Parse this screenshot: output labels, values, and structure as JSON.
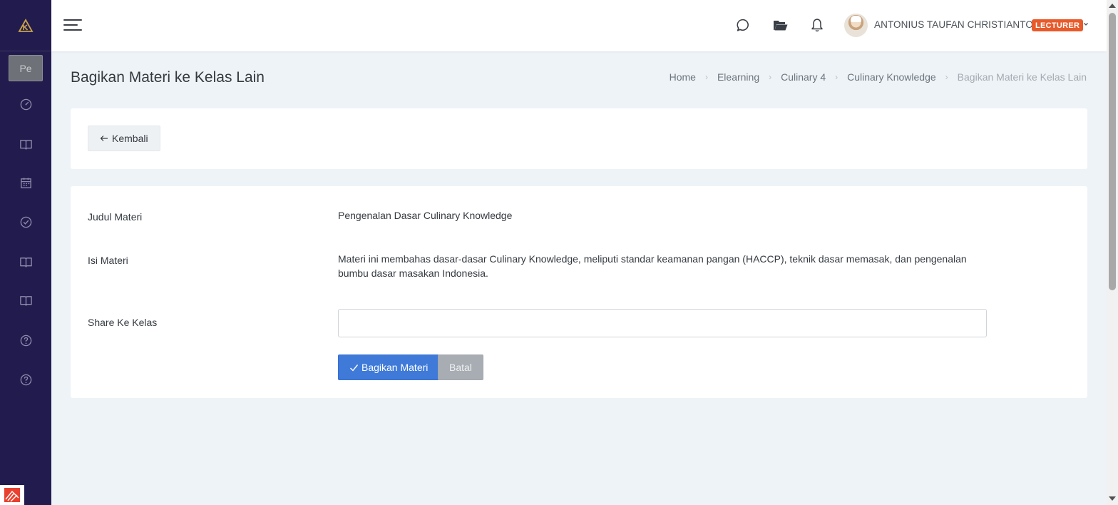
{
  "sidebar": {
    "logo_icon": "app-logo-icon",
    "collapsed_label": "Pe",
    "items": [
      {
        "icon": "dashboard-gauge-icon"
      },
      {
        "icon": "book-open-icon"
      },
      {
        "icon": "calendar-icon"
      },
      {
        "icon": "check-circle-icon"
      },
      {
        "icon": "book-open-icon"
      },
      {
        "icon": "book-open-icon"
      },
      {
        "icon": "help-circle-icon"
      },
      {
        "icon": "help-circle-icon"
      }
    ],
    "colors": {
      "background": "#221c4e",
      "icon": "#8f8cab"
    }
  },
  "topbar": {
    "menu_icon": "hamburger-menu-icon",
    "icons": [
      "chat-bubble-icon",
      "folder-open-icon",
      "bell-icon"
    ],
    "user": {
      "name": "ANTONIUS TAUFAN CHRISTIANTO",
      "role": "LECTURER",
      "role_color": "#e85a2a"
    }
  },
  "page": {
    "title": "Bagikan Materi ke Kelas Lain",
    "breadcrumb": [
      "Home",
      "Elearning",
      "Culinary 4",
      "Culinary Knowledge",
      "Bagikan Materi ke Kelas Lain"
    ]
  },
  "back_button": {
    "label": "Kembali",
    "icon": "arrow-left-icon"
  },
  "form": {
    "judul_label": "Judul Materi",
    "judul_value": "Pengenalan Dasar Culinary Knowledge",
    "isi_label": "Isi Materi",
    "isi_value": "Materi ini membahas dasar-dasar Culinary Knowledge, meliputi standar keamanan pangan (HACCP), teknik dasar memasak, dan pengenalan bumbu dasar masakan Indonesia.",
    "share_label": "Share Ke Kelas",
    "share_value": "",
    "submit_label": "Bagikan Materi",
    "submit_icon": "check-icon",
    "cancel_label": "Batal",
    "primary_color": "#3f7ad9"
  }
}
